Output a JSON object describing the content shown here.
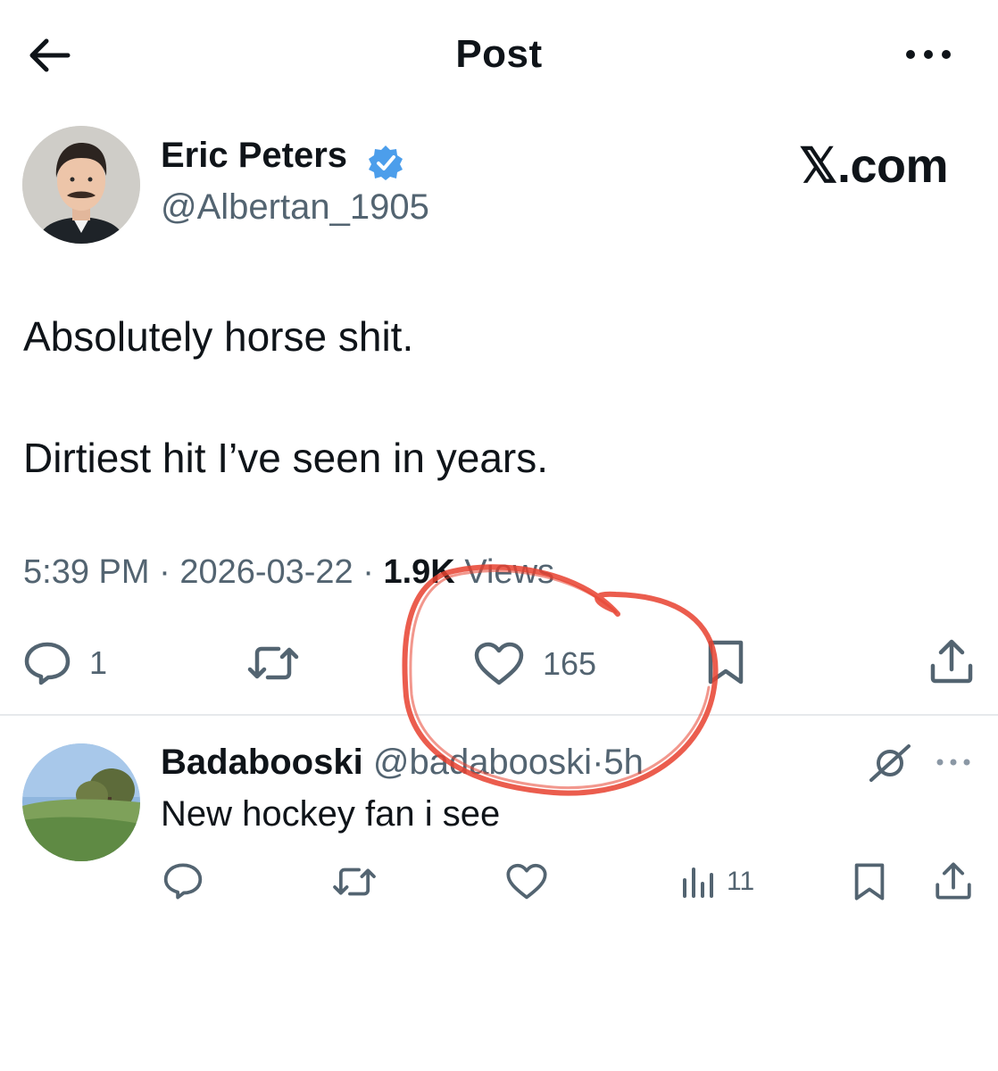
{
  "header": {
    "title": "Post",
    "back_icon": "arrow-left-icon",
    "more_icon": "more-horizontal-icon"
  },
  "post": {
    "author_name": "Eric Peters",
    "author_handle": "@Albertan_1905",
    "verified_icon": "verified-badge-icon",
    "verified_color": "#4c9eeb",
    "brand": "𝕏.com",
    "text_line1": "Absolutely horse shit.",
    "text_line2": "Dirtiest hit I’ve seen in years.",
    "time": "5:39 PM",
    "date": "2026-03-22",
    "views_count": "1.9K",
    "views_label": "Views",
    "actions": {
      "reply_count": "1",
      "like_count": "165"
    }
  },
  "reply": {
    "name": "Badabooski",
    "handle": "@badabooski",
    "separator": "·",
    "time": "5h",
    "text": "New hockey fan i see",
    "views_count": "11"
  },
  "annotation": {
    "color": "#e8412f",
    "shape": "hand-drawn circle around like count"
  },
  "colors": {
    "text": "#0f1419",
    "secondary": "#536471",
    "divider": "#e6e9ec"
  }
}
